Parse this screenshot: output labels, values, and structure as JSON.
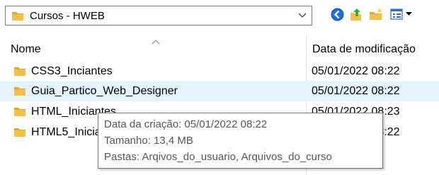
{
  "address_bar": {
    "path": "Cursos - HWEB",
    "folder_icon": "folder-icon",
    "dropdown_icon": "chevron-down-icon"
  },
  "toolbar": {
    "icons": [
      "back-icon",
      "up-folder-icon",
      "new-folder-icon",
      "view-menu-icon"
    ]
  },
  "columns": {
    "name": "Nome",
    "date_modified": "Data de modificação"
  },
  "rows": [
    {
      "name": "CSS3_Inciantes",
      "date": "05/01/2022 08:22",
      "selected": false
    },
    {
      "name": "Guia_Partico_Web_Designer",
      "date": "05/01/2022 08:22",
      "selected": true
    },
    {
      "name": "HTML_Iniciantes",
      "date": "05/01/2022 08:23",
      "selected": false
    },
    {
      "name": "HTML5_Iniciantes",
      "date": "05/01/2022 08:22",
      "selected": false
    }
  ],
  "tooltip": {
    "created": "Data da criação: 05/01/2022 08:22",
    "size": "Tamanho: 13,4 MB",
    "folders": "Pastas: Arqivos_do_usuario, Arquivos_do_curso"
  },
  "colors": {
    "folder": "#f5c04a",
    "selected_row": "#e5f3ff",
    "back_icon": "#1f6fd6",
    "up_arrow": "#3aa845"
  }
}
